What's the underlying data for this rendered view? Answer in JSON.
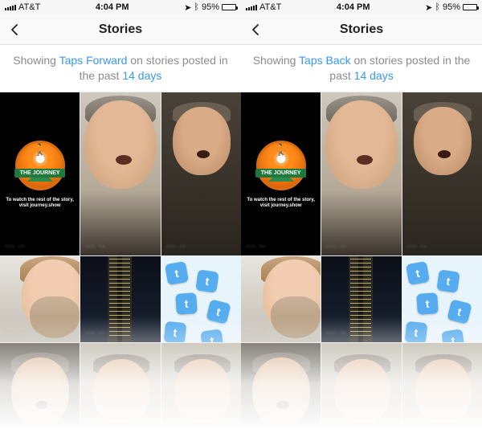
{
  "status": {
    "carrier": "AT&T",
    "time": "4:04 PM",
    "battery_pct": "95%",
    "icons": [
      "location",
      "bluetooth",
      "battery"
    ]
  },
  "nav": {
    "title": "Stories"
  },
  "panels": [
    {
      "filter_prefix": "Showing ",
      "filter_metric": "Taps Forward",
      "filter_mid": " on stories posted in the past ",
      "filter_days": "14 days",
      "journey_banner": "THE JOURNEY",
      "journey_sub": "To watch the rest of the story, visit journey.show"
    },
    {
      "filter_prefix": "Showing ",
      "filter_metric": "Taps Back",
      "filter_mid": " on stories posted in the past ",
      "filter_days": "14 days",
      "journey_banner": "THE JOURNEY",
      "journey_sub": "To watch the rest of the story, visit journey.show"
    }
  ],
  "metric_placeholder": "··· ··"
}
